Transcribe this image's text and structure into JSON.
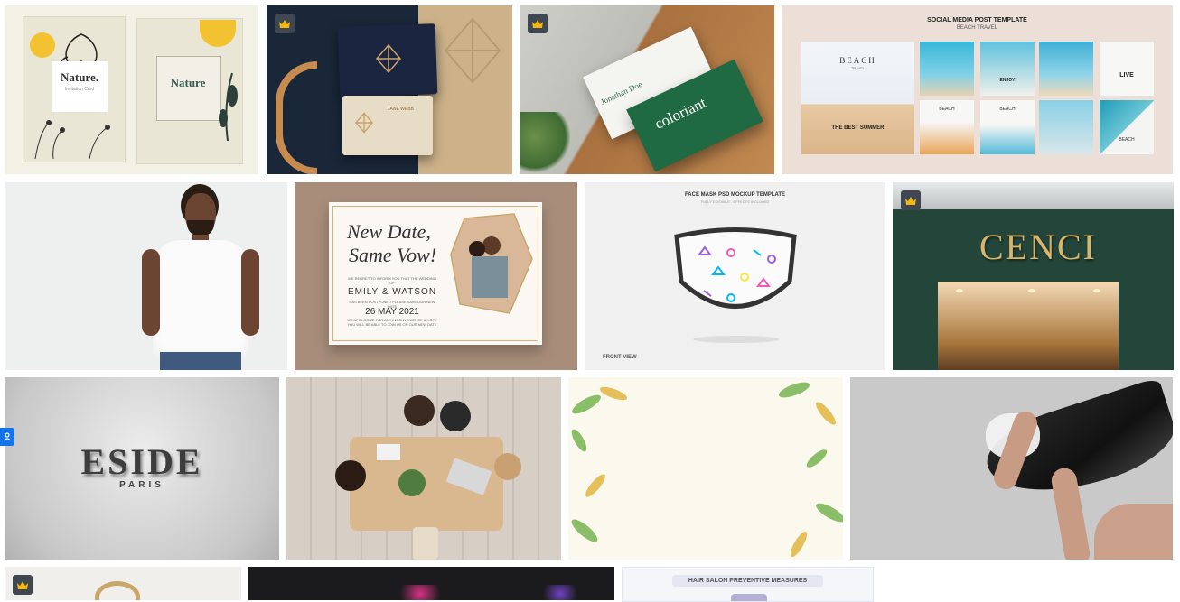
{
  "tiles": {
    "nature": {
      "title_left": "Nature.",
      "subtitle_left": "Invitation Card",
      "title_right": "Nature",
      "premium": false
    },
    "business_card_gold": {
      "name": "JANE WEBB",
      "premium": true
    },
    "coloriant": {
      "name_white": "Jonathan Doe",
      "brand": "coloriant",
      "premium": true
    },
    "social_beach": {
      "header": "SOCIAL MEDIA POST TEMPLATE",
      "subheader": "BEACH TRAVEL",
      "big_title": "BEACH",
      "big_sub": "TRAVEL",
      "big_footer": "THE BEST SUMMER",
      "squares": [
        "BEACH",
        "ENJOY",
        "BEACH",
        "LIVE",
        "BEACH",
        "BEACH",
        "BEACH",
        "BEACH"
      ],
      "premium": false
    },
    "tshirt_man": {
      "premium": false
    },
    "new_date": {
      "line1": "New Date,",
      "line2": "Same Vow!",
      "intro": "WE REGRET TO INFORM YOU THAT THE WEDDING OF",
      "names": "EMILY & WATSON",
      "postponed": "HAS BEEN POSTPONED PLEASE SAVE OUR NEW DATE",
      "date": "26 MAY 2021",
      "apology": "WE APOLOGIZE FOR ANY INCONVENIENCE & HOPE YOU WILL BE ABLE TO JOIN US ON OUR NEW DATE",
      "premium": false
    },
    "face_mask": {
      "header": "FACE MASK PSD MOCKUP TEMPLATE",
      "subheader": "FULLY EDITABLE - EFFECTS INCLUDED",
      "footer": "FRONT VIEW",
      "premium": false
    },
    "cenci": {
      "sign": "CENCI",
      "premium": true
    },
    "eside": {
      "brand": "ESIDE",
      "sub": "PARIS",
      "premium": false
    },
    "meeting": {
      "premium": false
    },
    "leaves": {
      "premium": false
    },
    "hair_wash": {
      "premium": false
    },
    "row4_gold": {
      "premium": true
    },
    "row4_dark": {
      "premium": false
    },
    "row4_salon": {
      "header": "HAIR SALON PREVENTIVE MEASURES",
      "premium": false
    }
  },
  "side_tab": {
    "icon": "user-icon"
  },
  "colors": {
    "crown_badge": "#3f4753",
    "crown": "#f5b70a",
    "side_tab": "#1273eb"
  }
}
